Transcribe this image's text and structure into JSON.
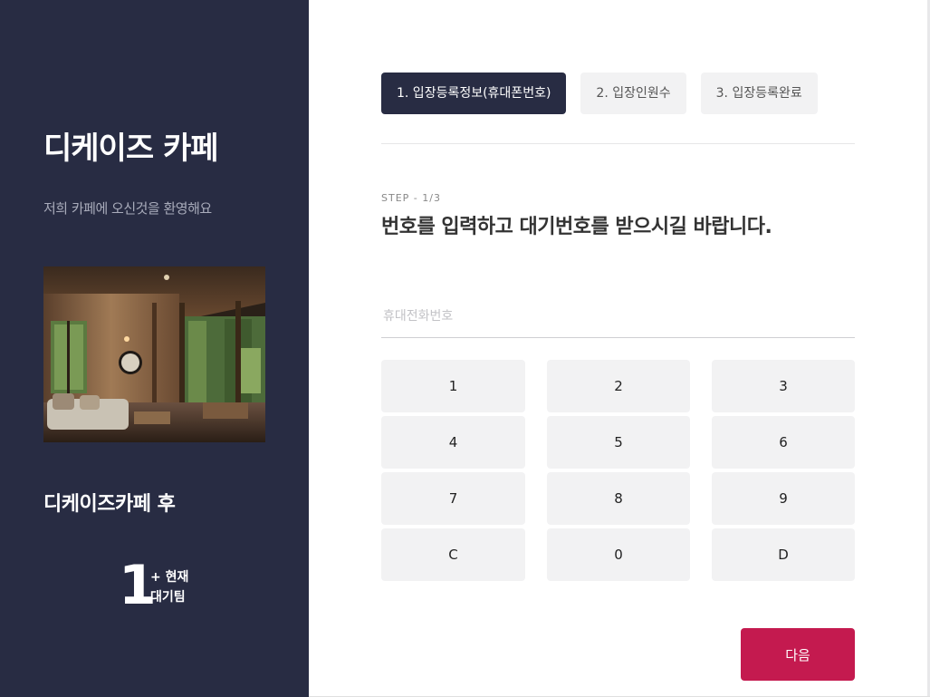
{
  "sidebar": {
    "title": "디케이즈 카페",
    "subtitle": "저희 카페에 오신것을 환영해요",
    "photo_alt": "cafe-interior-photo",
    "queue_title": "디케이즈카페 후",
    "queue_count": "1",
    "queue_label_line1": "+ 현재",
    "queue_label_line2": "대기팀"
  },
  "steps": [
    {
      "label": "1. 입장등록정보(휴대폰번호)",
      "active": true
    },
    {
      "label": "2. 입장인원수",
      "active": false
    },
    {
      "label": "3. 입장등록완료",
      "active": false
    }
  ],
  "main": {
    "step_indicator": "STEP - 1/3",
    "headline": "번호를 입력하고 대기번호를 받으시길 바랍니다.",
    "phone_placeholder": "휴대전화번호",
    "phone_value": "",
    "next_label": "다음"
  },
  "keypad": [
    "1",
    "2",
    "3",
    "4",
    "5",
    "6",
    "7",
    "8",
    "9",
    "C",
    "0",
    "D"
  ],
  "colors": {
    "sidebar_bg": "#282c43",
    "accent": "#c41a4f",
    "key_bg": "#f2f2f3"
  }
}
